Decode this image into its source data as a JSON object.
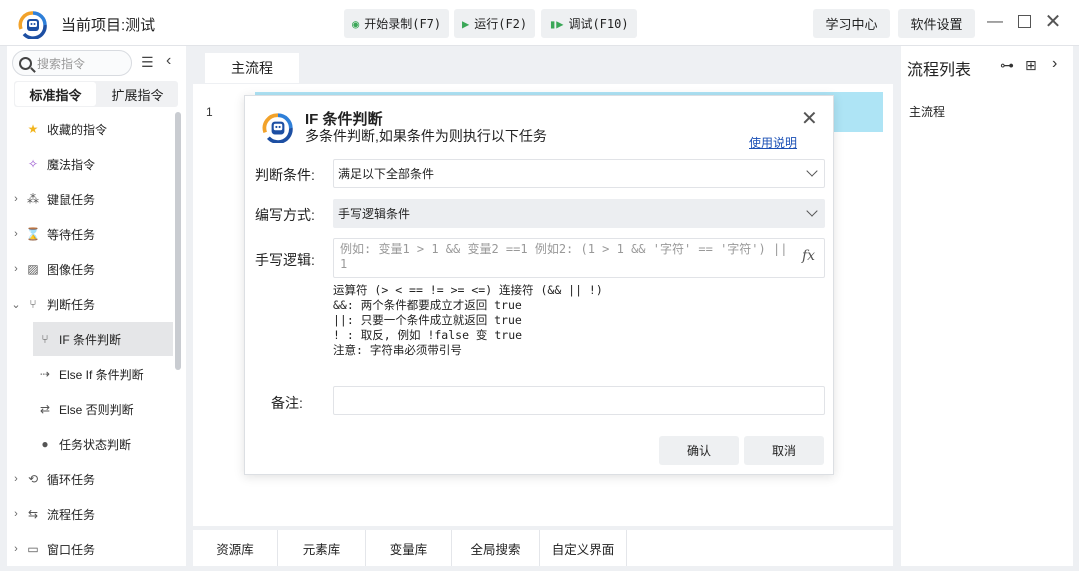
{
  "titlebar": {
    "project_label": "当前项目:测试",
    "record_btn": "开始录制(F7)",
    "run_btn": "运行(F2)",
    "debug_btn": "调试(F10)",
    "learn_btn": "学习中心",
    "settings_btn": "软件设置"
  },
  "sidebar": {
    "search_placeholder": "搜索指令",
    "tabs": [
      "标准指令",
      "扩展指令"
    ],
    "items": [
      {
        "label": "收藏的指令"
      },
      {
        "label": "魔法指令"
      },
      {
        "label": "键鼠任务"
      },
      {
        "label": "等待任务"
      },
      {
        "label": "图像任务"
      },
      {
        "label": "判断任务"
      },
      {
        "label": "IF 条件判断"
      },
      {
        "label": "Else If 条件判断"
      },
      {
        "label": "Else 否则判断"
      },
      {
        "label": "任务状态判断"
      },
      {
        "label": "循环任务"
      },
      {
        "label": "流程任务"
      },
      {
        "label": "窗口任务"
      }
    ]
  },
  "center": {
    "tab_label": "主流程",
    "line_number": "1",
    "bottom_tabs": [
      "资源库",
      "元素库",
      "变量库",
      "全局搜索",
      "自定义界面"
    ]
  },
  "right_panel": {
    "title": "流程列表",
    "item": "主流程"
  },
  "dialog": {
    "title": "IF 条件判断",
    "subtitle": "多条件判断,如果条件为则执行以下任务",
    "help_link": "使用说明",
    "condition_label": "判断条件:",
    "condition_value": "满足以下全部条件",
    "mode_label": "编写方式:",
    "mode_value": "手写逻辑条件",
    "logic_label": "手写逻辑:",
    "logic_placeholder": "例如: 变量1 > 1 && 变量2 ==1 例如2: (1 > 1 && '字符' == '字符') || 1",
    "help_lines": [
      "运算符 (> < == != >= <=) 连接符 (&& || !)",
      "&&: 两个条件都要成立才返回 true",
      "||: 只要一个条件成立就返回 true",
      "! : 取反, 例如 !false 变 true",
      "注意: 字符串必须带引号"
    ],
    "remark_label": "备注:",
    "confirm_btn": "确认",
    "cancel_btn": "取消"
  }
}
